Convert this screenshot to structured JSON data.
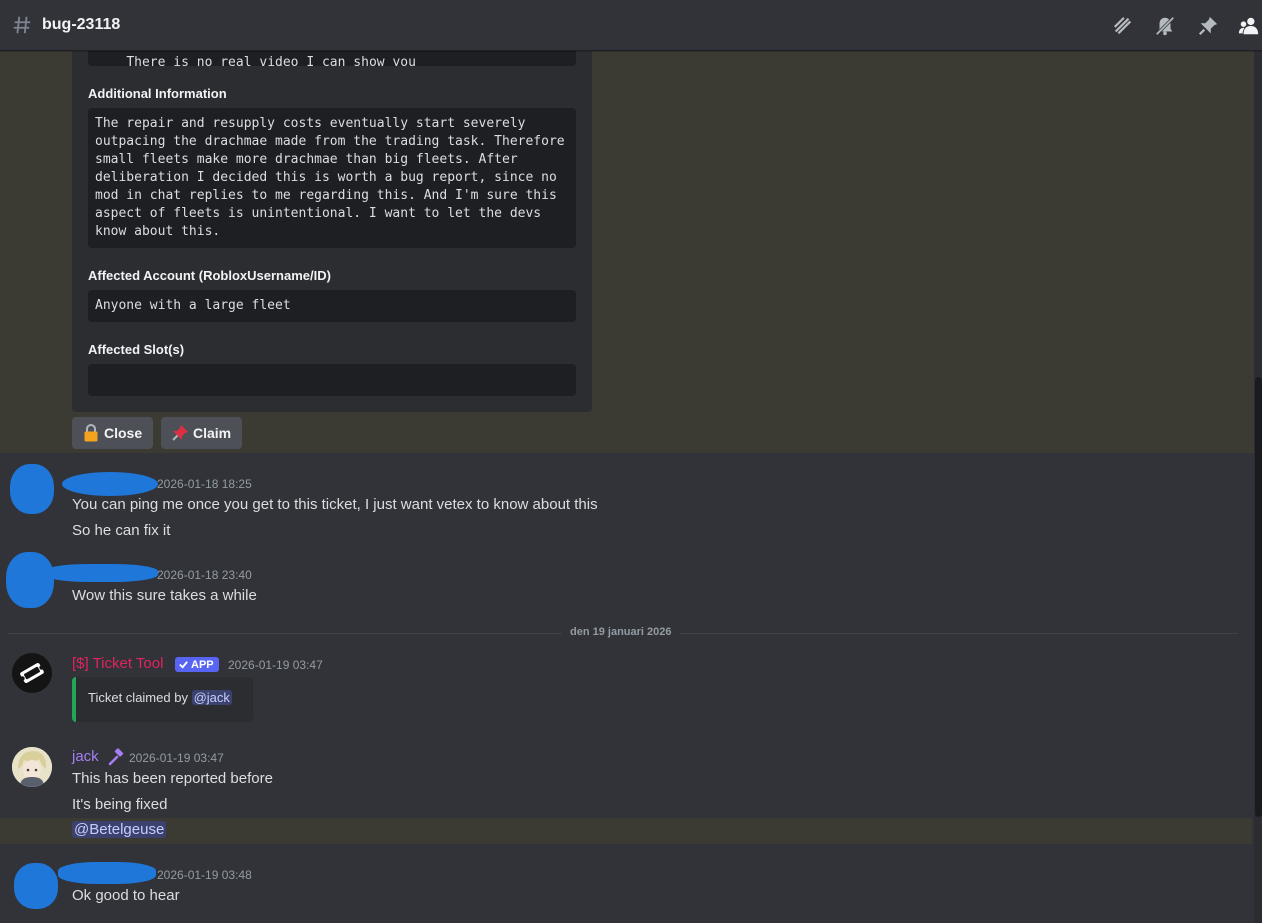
{
  "header": {
    "channel_name": "bug-23118",
    "icons": [
      "hash-icon",
      "threads-icon",
      "notification-muted-icon",
      "pin-icon",
      "members-icon"
    ]
  },
  "embed": {
    "cut_off_text": "There is no real video I can show you",
    "fields": [
      {
        "name": "Additional Information",
        "value": "The repair and resupply costs eventually start severely outpacing the drachmae made from the trading task. Therefore small fleets make more drachmae than big fleets. After deliberation I decided this is worth a bug report, since no mod in chat replies to me regarding this. And I'm sure this aspect of fleets is unintentional. I want to let the devs know about this."
      },
      {
        "name": "Affected Account (RobloxUsername/ID)",
        "value": "Anyone with a large fleet"
      },
      {
        "name": "Affected Slot(s)",
        "value": ""
      }
    ],
    "buttons": [
      {
        "label": "Close",
        "icon": "lock-icon"
      },
      {
        "label": "Claim",
        "icon": "pushpin-icon"
      }
    ]
  },
  "messages": [
    {
      "timestamp": "2026-01-18 18:25",
      "lines": [
        "You can ping me once you get to this ticket, I just want vetex to know about this",
        "So he can fix it"
      ]
    },
    {
      "timestamp": "2026-01-18 23:40",
      "lines": [
        "Wow this sure takes a while"
      ]
    },
    {
      "author": "[$] Ticket Tool",
      "author_color": "#e0245e",
      "badge": "APP",
      "timestamp": "2026-01-19 03:47",
      "embed_text": "Ticket claimed by",
      "embed_mention": "@jack"
    },
    {
      "author": "jack",
      "author_color": "#a47ff5",
      "timestamp": "2026-01-19 03:47",
      "lines": [
        "This has been reported before",
        "It's being fixed"
      ],
      "mention": "@Betelgeuse"
    },
    {
      "timestamp": "2026-01-19 03:48",
      "lines": [
        "Ok good to hear"
      ]
    }
  ],
  "date_divider": "den 19 januari 2026",
  "colors": {
    "background": "#313338",
    "embed_bg": "#2b2d31",
    "mention_highlight": "#3b3a33",
    "redaction": "#1f77d9",
    "app_badge": "#5865f2",
    "claim_bar": "#23a55a"
  }
}
